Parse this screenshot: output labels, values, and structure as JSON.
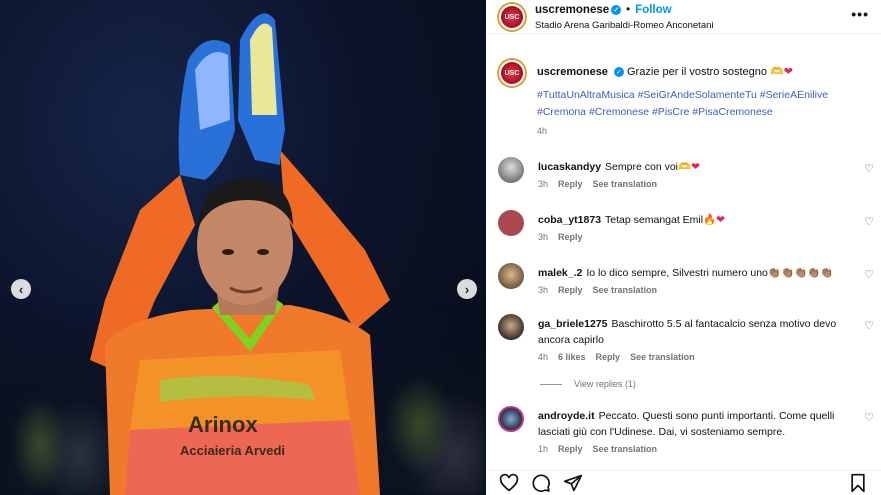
{
  "media": {
    "shirt_text_main": "Arinox",
    "shirt_text_sub": "Acciaieria Arvedi",
    "prev_arrow": "‹",
    "next_arrow": "›"
  },
  "post": {
    "username": "uscremonese",
    "follow_label": "Follow",
    "separator": "•",
    "location": "Stadio Arena Garibaldi-Romeo Anconetani",
    "more_label": "•••",
    "avatar_text": "USC"
  },
  "caption": {
    "username": "uscremonese",
    "text": "Grazie per il vostro sostegno 🫶",
    "heart": "❤",
    "hashtags": "#TuttaUnAltraMusica #SeiGrAndeSolamenteTu #SerieAEnilive #Cremona #Cremonese #PisCre #PisaCremonese",
    "time": "4h"
  },
  "comments": [
    {
      "username": "lucaskandyy",
      "text": "Sempre con voi🫶",
      "heart": "❤",
      "time": "3h",
      "reply": "Reply",
      "translate": "See translation"
    },
    {
      "username": "coba_yt1873",
      "text": "Tetap semangat Emil🔥",
      "heart": "❤",
      "time": "3h",
      "reply": "Reply"
    },
    {
      "username": "malek_.2",
      "text": "Io lo dico sempre, Silvestri numero uno👏🏽👏🏽👏🏽👏🏽👏🏽",
      "time": "3h",
      "reply": "Reply",
      "translate": "See translation"
    },
    {
      "username": "ga_briele1275",
      "text": "Baschirotto 5.5 al fantacalcio senza motivo devo ancora capirlo",
      "time": "4h",
      "likes": "6 likes",
      "reply": "Reply",
      "translate": "See translation"
    },
    {
      "username": "androyde.it",
      "text": "Peccato. Questi sono punti importanti. Come quelli lasciati giù con l'Udinese. Dai, vi sosteniamo sempre.",
      "time": "1h",
      "reply": "Reply",
      "translate": "See translation"
    }
  ],
  "view_replies": "View replies (1)",
  "icons": {
    "like": "heart-outline-icon",
    "comment": "comment-icon",
    "share": "paper-plane-icon",
    "save": "bookmark-icon"
  },
  "colors": {
    "link": "#0095f6",
    "hashtag": "#3a5ec1",
    "muted": "#737373",
    "heart": "#e0245e",
    "brand_red": "#b3122a"
  }
}
